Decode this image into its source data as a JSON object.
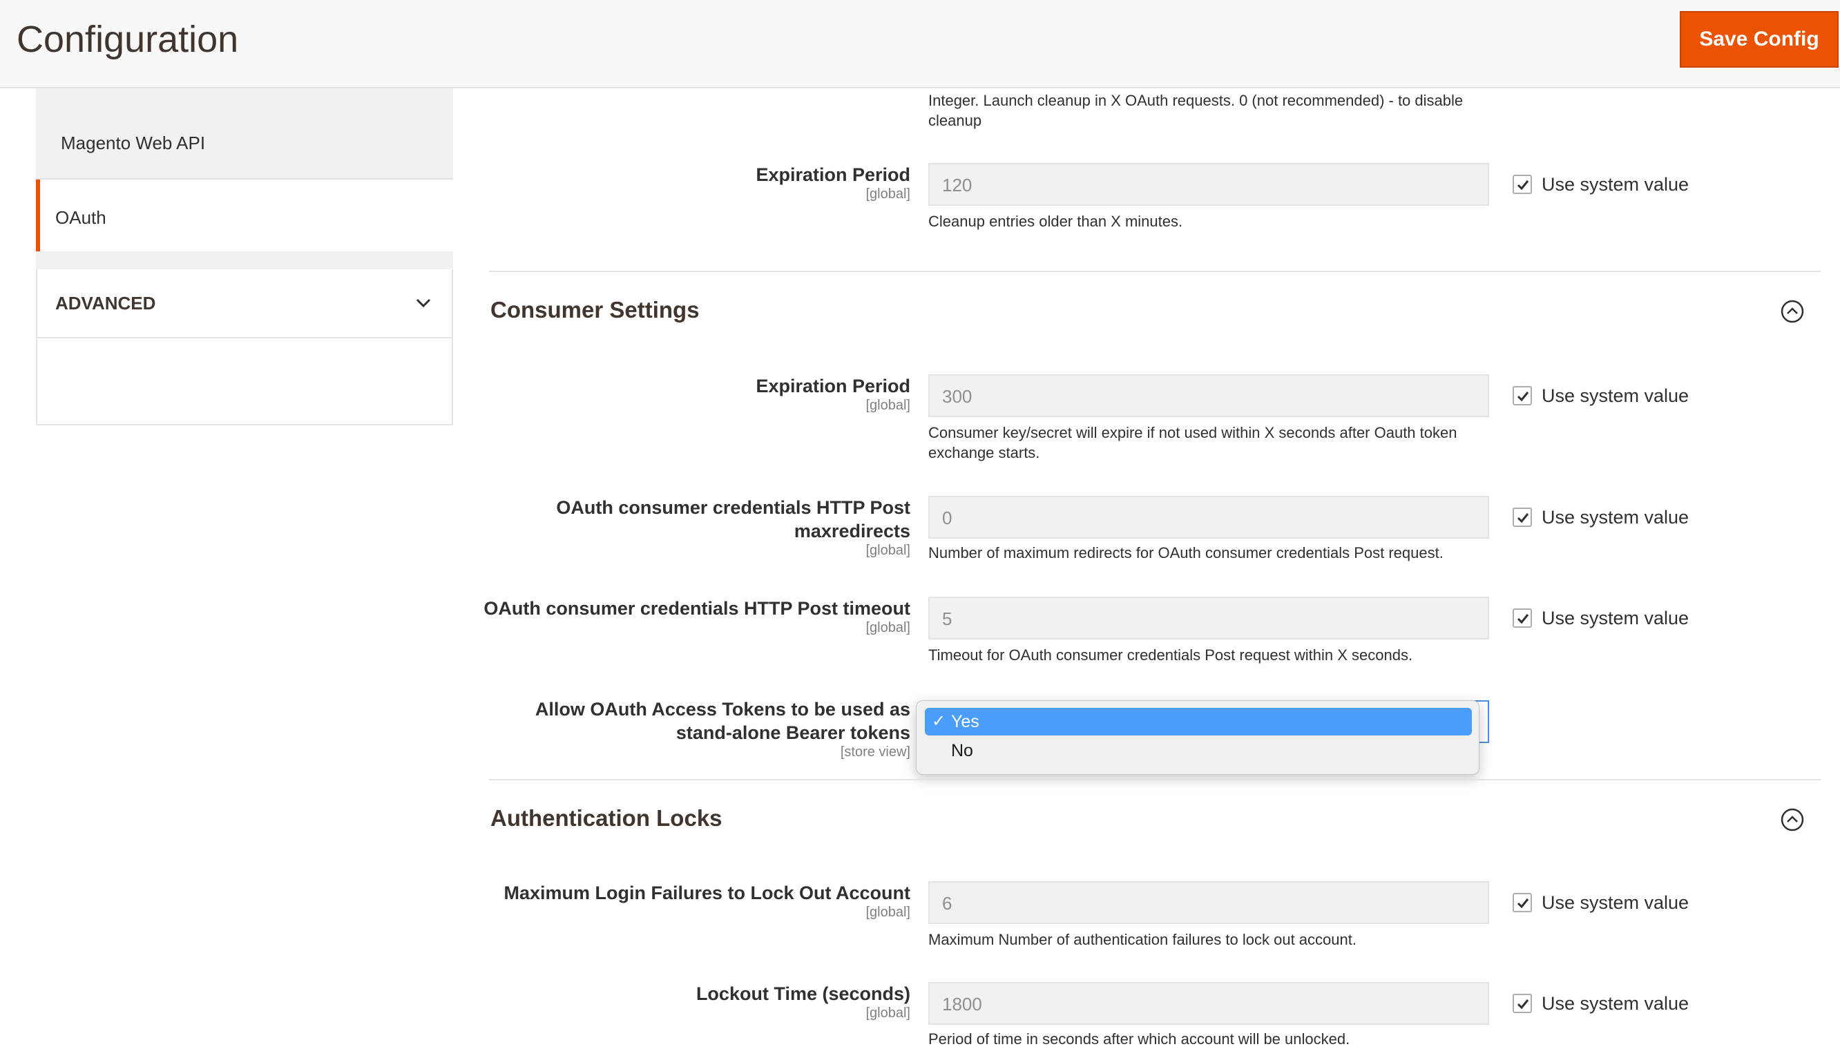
{
  "header": {
    "title": "Configuration",
    "save_label": "Save Config"
  },
  "sidebar": {
    "items": [
      {
        "label": "Magento Web API"
      },
      {
        "label": "OAuth"
      }
    ],
    "advanced_label": "ADVANCED"
  },
  "cleanup": {
    "top_note": "Integer. Launch cleanup in X OAuth requests. 0 (not recommended) - to disable cleanup",
    "expiration": {
      "label": "Expiration Period",
      "scope": "[global]",
      "value": "120",
      "note": "Cleanup entries older than X minutes.",
      "system_label": "Use system value"
    }
  },
  "consumer": {
    "title": "Consumer Settings",
    "expiration": {
      "label": "Expiration Period",
      "scope": "[global]",
      "value": "300",
      "note": "Consumer key/secret will expire if not used within X seconds after Oauth token exchange starts.",
      "system_label": "Use system value"
    },
    "maxredirects": {
      "label": "OAuth consumer credentials HTTP Post maxredirects",
      "scope": "[global]",
      "value": "0",
      "note": "Number of maximum redirects for OAuth consumer credentials Post request.",
      "system_label": "Use system value"
    },
    "timeout": {
      "label": "OAuth consumer credentials HTTP Post timeout",
      "scope": "[global]",
      "value": "5",
      "note": "Timeout for OAuth consumer credentials Post request within X seconds.",
      "system_label": "Use system value"
    },
    "bearer": {
      "label": "Allow OAuth Access Tokens to be used as stand-alone Bearer tokens",
      "scope": "[store view]",
      "options": [
        "Yes",
        "No"
      ],
      "selected": "Yes",
      "check_glyph": "✓"
    }
  },
  "locks": {
    "title": "Authentication Locks",
    "max_failures": {
      "label": "Maximum Login Failures to Lock Out Account",
      "scope": "[global]",
      "value": "6",
      "note": "Maximum Number of authentication failures to lock out account.",
      "system_label": "Use system value"
    },
    "lockout_time": {
      "label": "Lockout Time (seconds)",
      "scope": "[global]",
      "value": "1800",
      "note": "Period of time in seconds after which account will be unlocked.",
      "system_label": "Use system value"
    }
  },
  "colors": {
    "accent": "#eb5202",
    "dropdown_selected": "#4a9df8",
    "focus_border": "#4a90e2"
  },
  "icons": {
    "collapse": "chevron-up-circle-icon",
    "expand": "chevron-down-icon",
    "check": "checkmark-icon"
  }
}
